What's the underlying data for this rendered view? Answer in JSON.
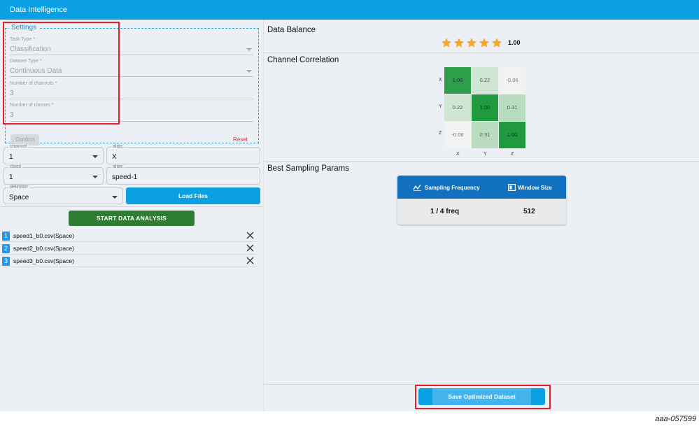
{
  "app": {
    "title": "Data Intelligence"
  },
  "settings": {
    "legend": "Settings",
    "task_type": {
      "label": "Task Type *",
      "value": "Classification"
    },
    "dataset_type": {
      "label": "Dataset Type *",
      "value": "Continuous Data"
    },
    "num_channels": {
      "label": "Number of channels *",
      "value": "3"
    },
    "num_classes": {
      "label": "Number of classes *",
      "value": "3"
    },
    "confirm_label": "Confirm",
    "reset_label": "Reset"
  },
  "channel_row": {
    "channel": {
      "label": "channel",
      "value": "1"
    },
    "alias": {
      "label": "alias",
      "value": "X"
    }
  },
  "class_row": {
    "class": {
      "label": "class",
      "value": "1"
    },
    "alias": {
      "label": "alias",
      "value": "speed-1"
    }
  },
  "delimiter": {
    "label": "delimiter",
    "value": "Space"
  },
  "load_files_label": "Load Files",
  "start_analysis_label": "START DATA ANALYSIS",
  "files": [
    {
      "num": "1",
      "name": "speed1_b0.csv(Space)"
    },
    {
      "num": "2",
      "name": "speed2_b0.csv(Space)"
    },
    {
      "num": "3",
      "name": "speed3_b0.csv(Space)"
    }
  ],
  "data_balance": {
    "title": "Data Balance",
    "stars": 5,
    "value": "1.00"
  },
  "channel_correlation": {
    "title": "Channel Correlation",
    "labels": [
      "X",
      "Y",
      "Z"
    ],
    "matrix": [
      [
        "1.00",
        "0.22",
        "-0.06"
      ],
      [
        "0.22",
        "1.00",
        "0.31"
      ],
      [
        "-0.06",
        "0.31",
        "1.00"
      ]
    ]
  },
  "best_sampling": {
    "title": "Best Sampling Params",
    "col1_header": "Sampling Frequency",
    "col2_header": "Window Size",
    "col1_value": "1 / 4 freq",
    "col2_value": "512"
  },
  "save_label": "Save Optimized Dataset",
  "figure_id": "aaa-057599",
  "colors": {
    "accent": "#0b9fe4",
    "start": "#2e7d32",
    "table_head": "#1170bf",
    "star": "#f5a623",
    "highlight": "#e41e2b"
  }
}
